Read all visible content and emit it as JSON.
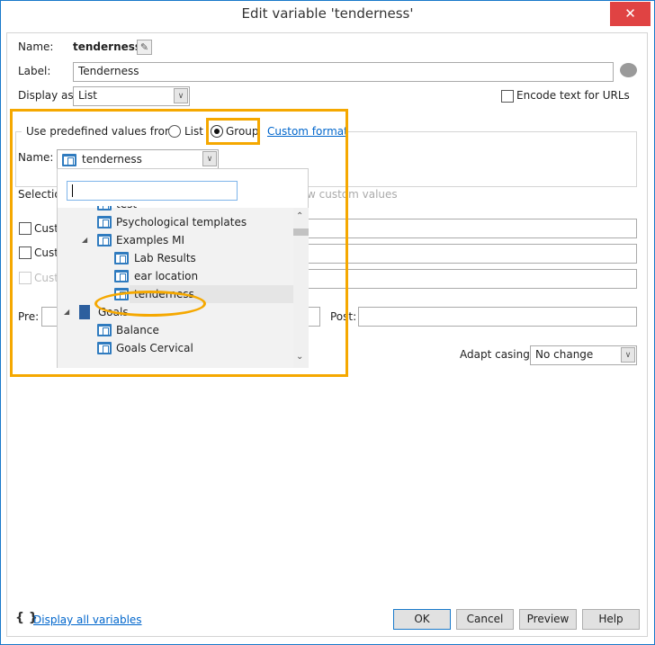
{
  "window": {
    "title": "Edit variable 'tenderness'",
    "close": "✕"
  },
  "name": {
    "label": "Name:",
    "value": "tenderness"
  },
  "label_row": {
    "label": "Label:",
    "value": "Tenderness"
  },
  "display_as": {
    "label": "Display as:",
    "value": "List"
  },
  "encode": {
    "label": "Encode text for URLs",
    "checked": false
  },
  "predefined": {
    "legend": "Use predefined values from:",
    "options": [
      "List",
      "Group"
    ],
    "selected": "Group",
    "custom_format": "Custom format"
  },
  "group_name": {
    "label": "Name:",
    "value": "tenderness"
  },
  "dropdown": {
    "search_value": "",
    "items": [
      {
        "label": "test",
        "level": 1
      },
      {
        "label": "Psychological templates",
        "level": 1
      },
      {
        "label": "Examples MI",
        "level": 1,
        "expanded": true
      },
      {
        "label": "Lab Results",
        "level": 2
      },
      {
        "label": "ear location",
        "level": 2
      },
      {
        "label": "tenderness",
        "level": 2,
        "selected": true
      },
      {
        "label": "Goals",
        "level": 0,
        "expanded": true
      },
      {
        "label": "Balance",
        "level": 1
      },
      {
        "label": "Goals Cervical",
        "level": 1
      }
    ]
  },
  "behind": {
    "selection": "Selection",
    "custom1": "Custo",
    "custom2": "Custo",
    "custom3": "Custo",
    "allow_custom": "w custom values"
  },
  "pre": {
    "label": "Pre:"
  },
  "post": {
    "label": "Post:"
  },
  "adapt_casing": {
    "label": "Adapt casing:",
    "value": "No change"
  },
  "footer": {
    "braces": "{ }",
    "display_all": "Display all variables",
    "ok": "OK",
    "cancel": "Cancel",
    "preview": "Preview",
    "help": "Help"
  },
  "colors": {
    "highlight": "#f5a800",
    "accent": "#1979ca",
    "close": "#e04343"
  }
}
